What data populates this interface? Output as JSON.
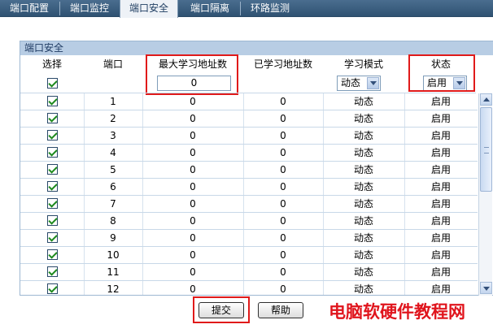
{
  "tabs": [
    {
      "label": "端口配置",
      "active": false
    },
    {
      "label": "端口监控",
      "active": false
    },
    {
      "label": "端口安全",
      "active": true
    },
    {
      "label": "端口隔离",
      "active": false
    },
    {
      "label": "环路监测",
      "active": false
    }
  ],
  "panel": {
    "title": "端口安全",
    "headers": {
      "select": "选择",
      "port": "端口",
      "max_learn": "最大学习地址数",
      "learned": "已学习地址数",
      "learn_mode": "学习模式",
      "status": "状态"
    },
    "controls": {
      "select_all_checked": true,
      "max_learn_value": "0",
      "learn_mode_value": "动态",
      "status_value": "启用"
    },
    "rows": [
      {
        "checked": true,
        "port": "1",
        "max_learn": "0",
        "learned": "0",
        "mode": "动态",
        "status": "启用"
      },
      {
        "checked": true,
        "port": "2",
        "max_learn": "0",
        "learned": "0",
        "mode": "动态",
        "status": "启用"
      },
      {
        "checked": true,
        "port": "3",
        "max_learn": "0",
        "learned": "0",
        "mode": "动态",
        "status": "启用"
      },
      {
        "checked": true,
        "port": "4",
        "max_learn": "0",
        "learned": "0",
        "mode": "动态",
        "status": "启用"
      },
      {
        "checked": true,
        "port": "5",
        "max_learn": "0",
        "learned": "0",
        "mode": "动态",
        "status": "启用"
      },
      {
        "checked": true,
        "port": "6",
        "max_learn": "0",
        "learned": "0",
        "mode": "动态",
        "status": "启用"
      },
      {
        "checked": true,
        "port": "7",
        "max_learn": "0",
        "learned": "0",
        "mode": "动态",
        "status": "启用"
      },
      {
        "checked": true,
        "port": "8",
        "max_learn": "0",
        "learned": "0",
        "mode": "动态",
        "status": "启用"
      },
      {
        "checked": true,
        "port": "9",
        "max_learn": "0",
        "learned": "0",
        "mode": "动态",
        "status": "启用"
      },
      {
        "checked": true,
        "port": "10",
        "max_learn": "0",
        "learned": "0",
        "mode": "动态",
        "status": "启用"
      },
      {
        "checked": true,
        "port": "11",
        "max_learn": "0",
        "learned": "0",
        "mode": "动态",
        "status": "启用"
      },
      {
        "checked": true,
        "port": "12",
        "max_learn": "0",
        "learned": "0",
        "mode": "动态",
        "status": "启用"
      }
    ]
  },
  "buttons": {
    "submit": "提交",
    "help": "帮助"
  },
  "watermark": "电脑软硬件教程网",
  "colors": {
    "tabbar": "#3a5e80",
    "panel_title_bg": "#b8cde4",
    "highlight_red": "#e01a1a",
    "checkmark_green": "#1e8a1e"
  }
}
